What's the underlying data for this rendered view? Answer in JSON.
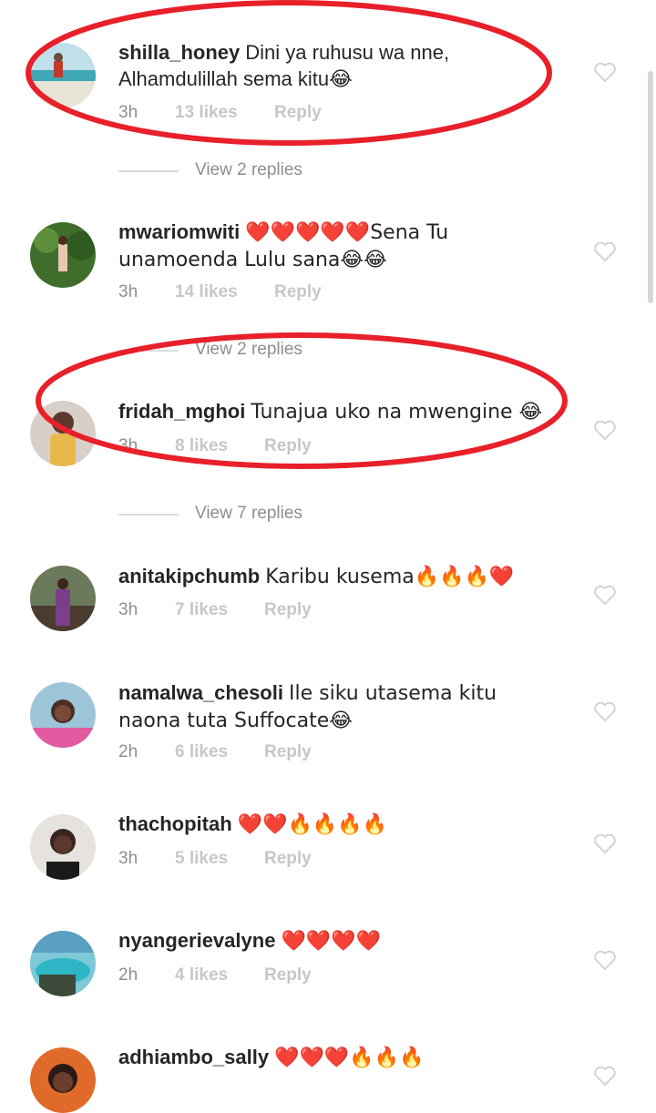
{
  "comments": [
    {
      "user": "shilla_honey",
      "text": "Dini ya ruhusu wa nne, Alhamdulillah sema kitu😂",
      "time": "3h",
      "likes": "13 likes",
      "reply": "Reply"
    },
    {
      "user": "mwariomwiti",
      "text": "❤️❤️❤️❤️❤️Sena Tu unamoenda Lulu sana😂😂",
      "time": "3h",
      "likes": "14 likes",
      "reply": "Reply"
    },
    {
      "user": "fridah_mghoi",
      "text": "Tunajua uko na mwengine 😂",
      "time": "3h",
      "likes": "8 likes",
      "reply": "Reply"
    },
    {
      "user": "anitakipchumb",
      "text": "Karibu kusema🔥🔥🔥❤️",
      "time": "3h",
      "likes": "7 likes",
      "reply": "Reply"
    },
    {
      "user": "namalwa_chesoli",
      "text": "Ile siku utasema kitu naona tuta Suffocate😂",
      "time": "2h",
      "likes": "6 likes",
      "reply": "Reply"
    },
    {
      "user": "thachopitah",
      "text": "❤️❤️🔥🔥🔥🔥",
      "time": "3h",
      "likes": "5 likes",
      "reply": "Reply"
    },
    {
      "user": "nyangerievalyne",
      "text": "❤️❤️❤️❤️",
      "time": "2h",
      "likes": "4 likes",
      "reply": "Reply"
    },
    {
      "user": "adhiambo_sally",
      "text": "❤️❤️❤️🔥🔥🔥",
      "time": "",
      "likes": "",
      "reply": ""
    }
  ],
  "view_replies": [
    {
      "label": "View 2 replies"
    },
    {
      "label": "View 2 replies"
    },
    {
      "label": "View 7 replies"
    }
  ],
  "icons": {
    "like": "heart-outline-icon"
  },
  "colors": {
    "annotation": "#e8202a",
    "muted": "#8e8e8e",
    "faded": "#c7c7c7"
  }
}
